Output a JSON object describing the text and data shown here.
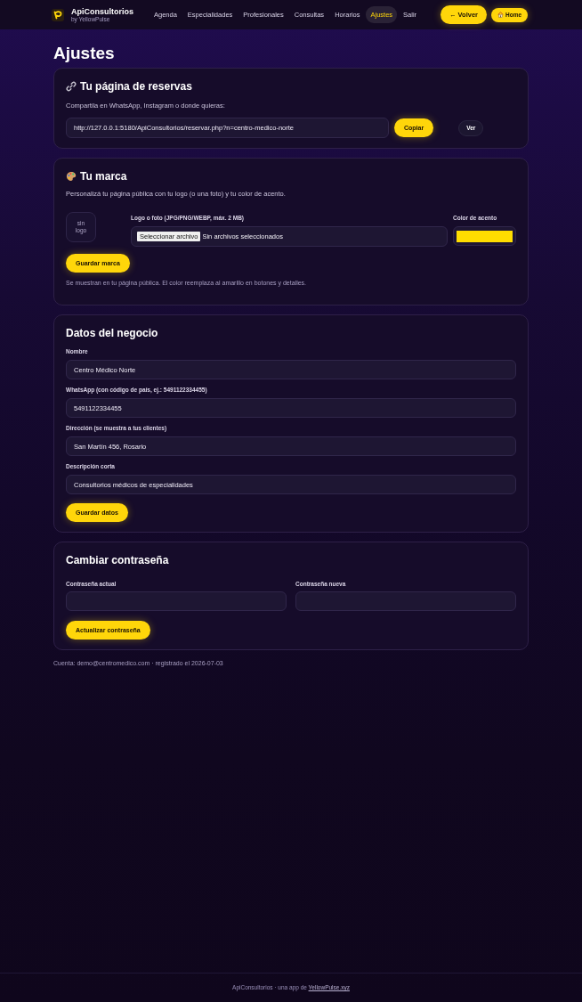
{
  "header": {
    "brand": {
      "name": "ApiConsultorios",
      "tagline": "by YellowPulse"
    },
    "nav": [
      {
        "label": "Agenda",
        "selected": false
      },
      {
        "label": "Especialidades",
        "selected": false
      },
      {
        "label": "Profesionales",
        "selected": false
      },
      {
        "label": "Consultas",
        "selected": false
      },
      {
        "label": "Horarios",
        "selected": false
      },
      {
        "label": "Ajustes",
        "selected": true
      },
      {
        "label": "Salir",
        "selected": false
      }
    ],
    "actions": [
      {
        "kind": "back",
        "label": "← Volver"
      },
      {
        "kind": "home",
        "label": "Home"
      }
    ]
  },
  "page_title": "Ajustes",
  "booking_link": {
    "title": "Tu página de reservas",
    "subtitle": "Compartila en WhatsApp, Instagram o donde quieras:",
    "url": "http://127.0.0.1:5180/ApiConsultorios/reservar.php?n=centro-medico-norte",
    "buttons": [
      {
        "kind": "primary",
        "label": "Copiar"
      },
      {
        "kind": "secondary",
        "label": "Ver"
      }
    ]
  },
  "brand": {
    "title": "Tu marca",
    "description": "Personalizá tu página pública con tu logo (o una foto) y tu color de acento.",
    "logo_preview": "sin logo",
    "file_field": {
      "label": "Logo o foto (JPG/PNG/WEBP, máx. 2 MB)",
      "button": "Seleccionar archivo",
      "status": "Sin archivos seleccionados"
    },
    "accent_field": {
      "label": "Color de acento",
      "color": "#ffdd00"
    },
    "save_button": "Guardar marca",
    "note": "Se muestran en tu página pública. El color reemplaza al amarillo en botones y detalles."
  },
  "business": {
    "title": "Datos del negocio",
    "fields": [
      {
        "label": "Nombre",
        "value": "Centro Médico Norte"
      },
      {
        "label": "WhatsApp (con código de país, ej.: 5491122334455)",
        "value": "5491122334455"
      },
      {
        "label": "Dirección (se muestra a tus clientes)",
        "value": "San Martín 456, Rosario"
      },
      {
        "label": "Descripción corta",
        "value": "Consultorios médicos de especialidades"
      }
    ],
    "save_button": "Guardar datos"
  },
  "password": {
    "title": "Cambiar contraseña",
    "fields": [
      {
        "label": "Contraseña actual"
      },
      {
        "label": "Contraseña nueva"
      }
    ],
    "save_button": "Actualizar contraseña"
  },
  "account_note": "Cuenta: demo@centromedico.com · registrado el 2026-07-03",
  "footer": {
    "text": "ApiConsultorios · una app de ",
    "link": "YellowPulse.xyz"
  }
}
